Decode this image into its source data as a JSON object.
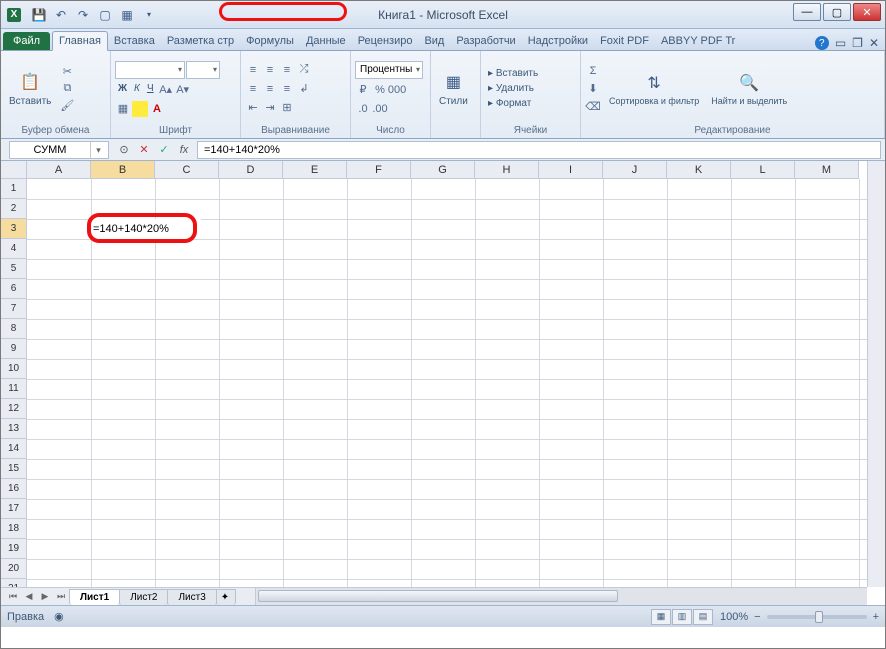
{
  "title": "Книга1 - Microsoft Excel",
  "ribbon": {
    "file": "Файл",
    "tabs": [
      "Главная",
      "Вставка",
      "Разметка стр",
      "Формулы",
      "Данные",
      "Рецензиро",
      "Вид",
      "Разработчи",
      "Надстройки",
      "Foxit PDF",
      "ABBYY PDF Tr"
    ],
    "active_tab_index": 0,
    "groups": {
      "clipboard": {
        "label": "Буфер обмена",
        "paste": "Вставить"
      },
      "font": {
        "label": "Шрифт",
        "bold": "Ж",
        "italic": "К",
        "underline": "Ч"
      },
      "alignment": {
        "label": "Выравнивание"
      },
      "number": {
        "label": "Число",
        "format": "Процентны"
      },
      "styles": {
        "label": "",
        "btn": "Стили"
      },
      "cells": {
        "label": "Ячейки",
        "insert": "Вставить",
        "delete": "Удалить",
        "format": "Формат"
      },
      "editing": {
        "label": "Редактирование",
        "sort": "Сортировка и фильтр",
        "find": "Найти и выделить"
      }
    }
  },
  "formula_bar": {
    "namebox": "СУММ",
    "formula": "=140+140*20%"
  },
  "grid": {
    "columns": [
      "A",
      "B",
      "C",
      "D",
      "E",
      "F",
      "G",
      "H",
      "I",
      "J",
      "K",
      "L",
      "M"
    ],
    "rows": 21,
    "active_col": 1,
    "active_row": 2,
    "active_cell_value": "=140+140*20%"
  },
  "sheet_tabs": {
    "tabs": [
      "Лист1",
      "Лист2",
      "Лист3"
    ],
    "active": 0
  },
  "status": {
    "mode": "Правка",
    "zoom": "100%"
  }
}
